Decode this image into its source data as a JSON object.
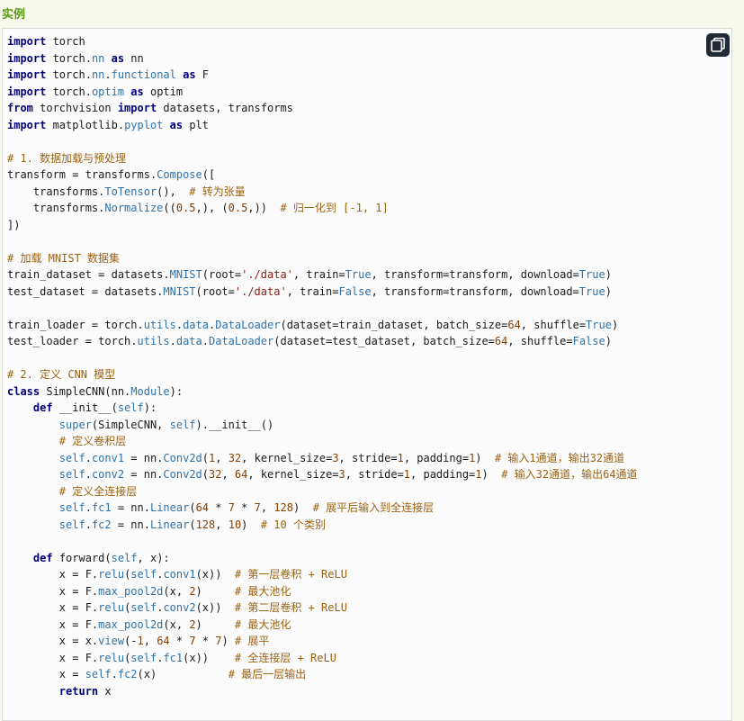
{
  "section": {
    "title": "实例"
  },
  "copy_button": {
    "icon": "copy-icon"
  },
  "code_lines": [
    [
      [
        "kw",
        "import"
      ],
      [
        "plain",
        " torch"
      ]
    ],
    [
      [
        "kw",
        "import"
      ],
      [
        "plain",
        " torch."
      ],
      [
        "fn",
        "nn"
      ],
      [
        "plain",
        " "
      ],
      [
        "kw",
        "as"
      ],
      [
        "plain",
        " nn"
      ]
    ],
    [
      [
        "kw",
        "import"
      ],
      [
        "plain",
        " torch."
      ],
      [
        "fn",
        "nn"
      ],
      [
        "plain",
        "."
      ],
      [
        "fn",
        "functional"
      ],
      [
        "plain",
        " "
      ],
      [
        "kw",
        "as"
      ],
      [
        "plain",
        " F"
      ]
    ],
    [
      [
        "kw",
        "import"
      ],
      [
        "plain",
        " torch."
      ],
      [
        "fn",
        "optim"
      ],
      [
        "plain",
        " "
      ],
      [
        "kw",
        "as"
      ],
      [
        "plain",
        " optim"
      ]
    ],
    [
      [
        "kw",
        "from"
      ],
      [
        "plain",
        " torchvision "
      ],
      [
        "kw",
        "import"
      ],
      [
        "plain",
        " datasets, transforms"
      ]
    ],
    [
      [
        "kw",
        "import"
      ],
      [
        "plain",
        " matplotlib."
      ],
      [
        "fn",
        "pyplot"
      ],
      [
        "plain",
        " "
      ],
      [
        "kw",
        "as"
      ],
      [
        "plain",
        " plt"
      ]
    ],
    [],
    [
      [
        "cm",
        "# 1. 数据加载与预处理"
      ]
    ],
    [
      [
        "plain",
        "transform = transforms."
      ],
      [
        "fn",
        "Compose"
      ],
      [
        "plain",
        "(["
      ]
    ],
    [
      [
        "plain",
        "    transforms."
      ],
      [
        "fn",
        "ToTensor"
      ],
      [
        "plain",
        "(),  "
      ],
      [
        "cm",
        "# 转为张量"
      ]
    ],
    [
      [
        "plain",
        "    transforms."
      ],
      [
        "fn",
        "Normalize"
      ],
      [
        "plain",
        "(("
      ],
      [
        "num",
        "0.5"
      ],
      [
        "plain",
        ",), ("
      ],
      [
        "num",
        "0.5"
      ],
      [
        "plain",
        ",))  "
      ],
      [
        "cm",
        "# 归一化到 [-1, 1]"
      ]
    ],
    [
      [
        "plain",
        "])"
      ]
    ],
    [],
    [
      [
        "cm",
        "# 加载 MNIST 数据集"
      ]
    ],
    [
      [
        "plain",
        "train_dataset = datasets."
      ],
      [
        "fn",
        "MNIST"
      ],
      [
        "plain",
        "(root="
      ],
      [
        "str",
        "'./data'"
      ],
      [
        "plain",
        ", train="
      ],
      [
        "bool",
        "True"
      ],
      [
        "plain",
        ", transform=transform, download="
      ],
      [
        "bool",
        "True"
      ],
      [
        "plain",
        ")"
      ]
    ],
    [
      [
        "plain",
        "test_dataset = datasets."
      ],
      [
        "fn",
        "MNIST"
      ],
      [
        "plain",
        "(root="
      ],
      [
        "str",
        "'./data'"
      ],
      [
        "plain",
        ", train="
      ],
      [
        "bool",
        "False"
      ],
      [
        "plain",
        ", transform=transform, download="
      ],
      [
        "bool",
        "True"
      ],
      [
        "plain",
        ")"
      ]
    ],
    [],
    [
      [
        "plain",
        "train_loader = torch."
      ],
      [
        "fn",
        "utils"
      ],
      [
        "plain",
        "."
      ],
      [
        "fn",
        "data"
      ],
      [
        "plain",
        "."
      ],
      [
        "fn",
        "DataLoader"
      ],
      [
        "plain",
        "(dataset=train_dataset, batch_size="
      ],
      [
        "num",
        "64"
      ],
      [
        "plain",
        ", shuffle="
      ],
      [
        "bool",
        "True"
      ],
      [
        "plain",
        ")"
      ]
    ],
    [
      [
        "plain",
        "test_loader = torch."
      ],
      [
        "fn",
        "utils"
      ],
      [
        "plain",
        "."
      ],
      [
        "fn",
        "data"
      ],
      [
        "plain",
        "."
      ],
      [
        "fn",
        "DataLoader"
      ],
      [
        "plain",
        "(dataset=test_dataset, batch_size="
      ],
      [
        "num",
        "64"
      ],
      [
        "plain",
        ", shuffle="
      ],
      [
        "bool",
        "False"
      ],
      [
        "plain",
        ")"
      ]
    ],
    [],
    [
      [
        "cm",
        "# 2. 定义 CNN 模型"
      ]
    ],
    [
      [
        "kw",
        "class"
      ],
      [
        "plain",
        " SimpleCNN(nn."
      ],
      [
        "fn",
        "Module"
      ],
      [
        "plain",
        "):"
      ]
    ],
    [
      [
        "plain",
        "    "
      ],
      [
        "kw",
        "def"
      ],
      [
        "plain",
        " __init__("
      ],
      [
        "self",
        "self"
      ],
      [
        "plain",
        "):"
      ]
    ],
    [
      [
        "plain",
        "        "
      ],
      [
        "self",
        "super"
      ],
      [
        "plain",
        "(SimpleCNN, "
      ],
      [
        "self",
        "self"
      ],
      [
        "plain",
        ").__init__()"
      ]
    ],
    [
      [
        "plain",
        "        "
      ],
      [
        "cm",
        "# 定义卷积层"
      ]
    ],
    [
      [
        "plain",
        "        "
      ],
      [
        "self",
        "self"
      ],
      [
        "plain",
        "."
      ],
      [
        "fn",
        "conv1"
      ],
      [
        "plain",
        " = nn."
      ],
      [
        "fn",
        "Conv2d"
      ],
      [
        "plain",
        "("
      ],
      [
        "num",
        "1"
      ],
      [
        "plain",
        ", "
      ],
      [
        "num",
        "32"
      ],
      [
        "plain",
        ", kernel_size="
      ],
      [
        "num",
        "3"
      ],
      [
        "plain",
        ", stride="
      ],
      [
        "num",
        "1"
      ],
      [
        "plain",
        ", padding="
      ],
      [
        "num",
        "1"
      ],
      [
        "plain",
        ")  "
      ],
      [
        "cm",
        "# 输入1通道，输出32通道"
      ]
    ],
    [
      [
        "plain",
        "        "
      ],
      [
        "self",
        "self"
      ],
      [
        "plain",
        "."
      ],
      [
        "fn",
        "conv2"
      ],
      [
        "plain",
        " = nn."
      ],
      [
        "fn",
        "Conv2d"
      ],
      [
        "plain",
        "("
      ],
      [
        "num",
        "32"
      ],
      [
        "plain",
        ", "
      ],
      [
        "num",
        "64"
      ],
      [
        "plain",
        ", kernel_size="
      ],
      [
        "num",
        "3"
      ],
      [
        "plain",
        ", stride="
      ],
      [
        "num",
        "1"
      ],
      [
        "plain",
        ", padding="
      ],
      [
        "num",
        "1"
      ],
      [
        "plain",
        ")  "
      ],
      [
        "cm",
        "# 输入32通道，输出64通道"
      ]
    ],
    [
      [
        "plain",
        "        "
      ],
      [
        "cm",
        "# 定义全连接层"
      ]
    ],
    [
      [
        "plain",
        "        "
      ],
      [
        "self",
        "self"
      ],
      [
        "plain",
        "."
      ],
      [
        "fn",
        "fc1"
      ],
      [
        "plain",
        " = nn."
      ],
      [
        "fn",
        "Linear"
      ],
      [
        "plain",
        "("
      ],
      [
        "num",
        "64"
      ],
      [
        "plain",
        " * "
      ],
      [
        "num",
        "7"
      ],
      [
        "plain",
        " * "
      ],
      [
        "num",
        "7"
      ],
      [
        "plain",
        ", "
      ],
      [
        "num",
        "128"
      ],
      [
        "plain",
        ")  "
      ],
      [
        "cm",
        "# 展平后输入到全连接层"
      ]
    ],
    [
      [
        "plain",
        "        "
      ],
      [
        "self",
        "self"
      ],
      [
        "plain",
        "."
      ],
      [
        "fn",
        "fc2"
      ],
      [
        "plain",
        " = nn."
      ],
      [
        "fn",
        "Linear"
      ],
      [
        "plain",
        "("
      ],
      [
        "num",
        "128"
      ],
      [
        "plain",
        ", "
      ],
      [
        "num",
        "10"
      ],
      [
        "plain",
        ")  "
      ],
      [
        "cm",
        "# 10 个类别"
      ]
    ],
    [],
    [
      [
        "plain",
        "    "
      ],
      [
        "kw",
        "def"
      ],
      [
        "plain",
        " forward("
      ],
      [
        "self",
        "self"
      ],
      [
        "plain",
        ", x):"
      ]
    ],
    [
      [
        "plain",
        "        x = F."
      ],
      [
        "fn",
        "relu"
      ],
      [
        "plain",
        "("
      ],
      [
        "self",
        "self"
      ],
      [
        "plain",
        "."
      ],
      [
        "fn",
        "conv1"
      ],
      [
        "plain",
        "(x))  "
      ],
      [
        "cm",
        "# 第一层卷积 + ReLU"
      ]
    ],
    [
      [
        "plain",
        "        x = F."
      ],
      [
        "fn",
        "max_pool2d"
      ],
      [
        "plain",
        "(x, "
      ],
      [
        "num",
        "2"
      ],
      [
        "plain",
        ")     "
      ],
      [
        "cm",
        "# 最大池化"
      ]
    ],
    [
      [
        "plain",
        "        x = F."
      ],
      [
        "fn",
        "relu"
      ],
      [
        "plain",
        "("
      ],
      [
        "self",
        "self"
      ],
      [
        "plain",
        "."
      ],
      [
        "fn",
        "conv2"
      ],
      [
        "plain",
        "(x))  "
      ],
      [
        "cm",
        "# 第二层卷积 + ReLU"
      ]
    ],
    [
      [
        "plain",
        "        x = F."
      ],
      [
        "fn",
        "max_pool2d"
      ],
      [
        "plain",
        "(x, "
      ],
      [
        "num",
        "2"
      ],
      [
        "plain",
        ")     "
      ],
      [
        "cm",
        "# 最大池化"
      ]
    ],
    [
      [
        "plain",
        "        x = x."
      ],
      [
        "fn",
        "view"
      ],
      [
        "plain",
        "(-"
      ],
      [
        "num",
        "1"
      ],
      [
        "plain",
        ", "
      ],
      [
        "num",
        "64"
      ],
      [
        "plain",
        " * "
      ],
      [
        "num",
        "7"
      ],
      [
        "plain",
        " * "
      ],
      [
        "num",
        "7"
      ],
      [
        "plain",
        ") "
      ],
      [
        "cm",
        "# 展平"
      ]
    ],
    [
      [
        "plain",
        "        x = F."
      ],
      [
        "fn",
        "relu"
      ],
      [
        "plain",
        "("
      ],
      [
        "self",
        "self"
      ],
      [
        "plain",
        "."
      ],
      [
        "fn",
        "fc1"
      ],
      [
        "plain",
        "(x))    "
      ],
      [
        "cm",
        "# 全连接层 + ReLU"
      ]
    ],
    [
      [
        "plain",
        "        x = "
      ],
      [
        "self",
        "self"
      ],
      [
        "plain",
        "."
      ],
      [
        "fn",
        "fc2"
      ],
      [
        "plain",
        "(x)           "
      ],
      [
        "cm",
        "# 最后一层输出"
      ]
    ],
    [
      [
        "plain",
        "        "
      ],
      [
        "kw",
        "return"
      ],
      [
        "plain",
        " x"
      ]
    ]
  ]
}
